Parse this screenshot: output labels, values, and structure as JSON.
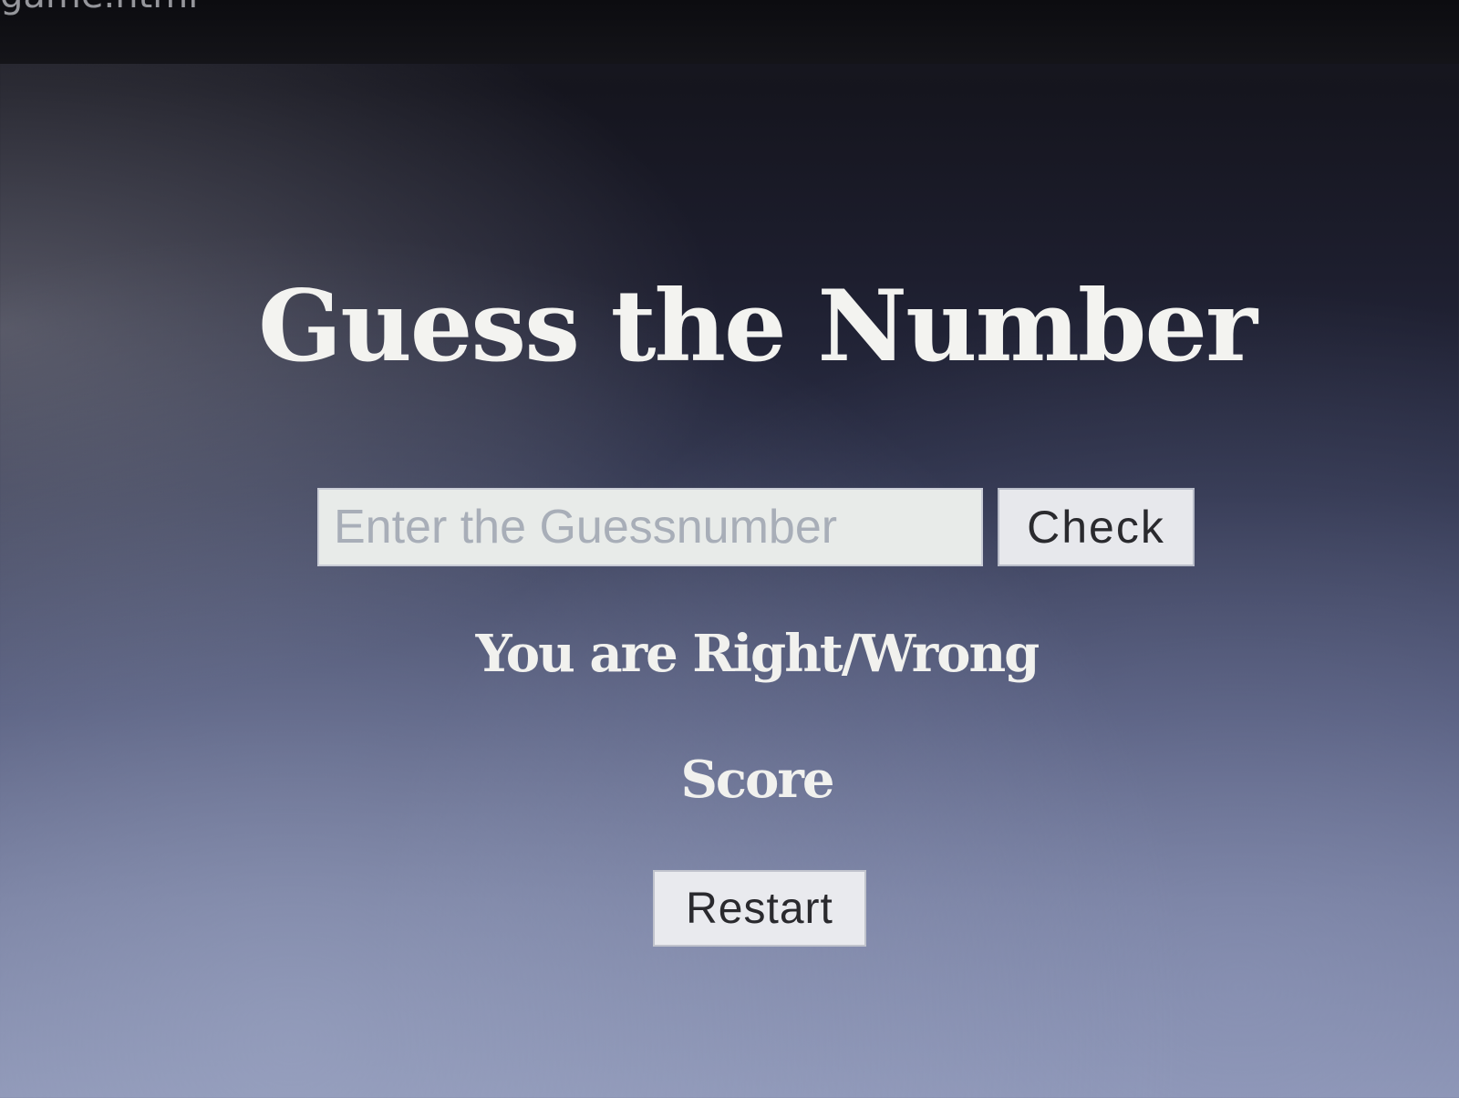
{
  "window": {
    "tab_title": "game.html"
  },
  "game": {
    "title": "Guess the Number",
    "input": {
      "placeholder": "Enter the Guessnumber",
      "value": ""
    },
    "check_label": "Check",
    "result_text": "You are Right/Wrong",
    "score_label": "Score",
    "restart_label": "Restart"
  },
  "colors": {
    "background_top": "#15151e",
    "background_bottom": "#8a92b2",
    "text": "#f3f3f0",
    "button_bg": "#e7e8ec",
    "input_bg": "#e8ebe9"
  }
}
